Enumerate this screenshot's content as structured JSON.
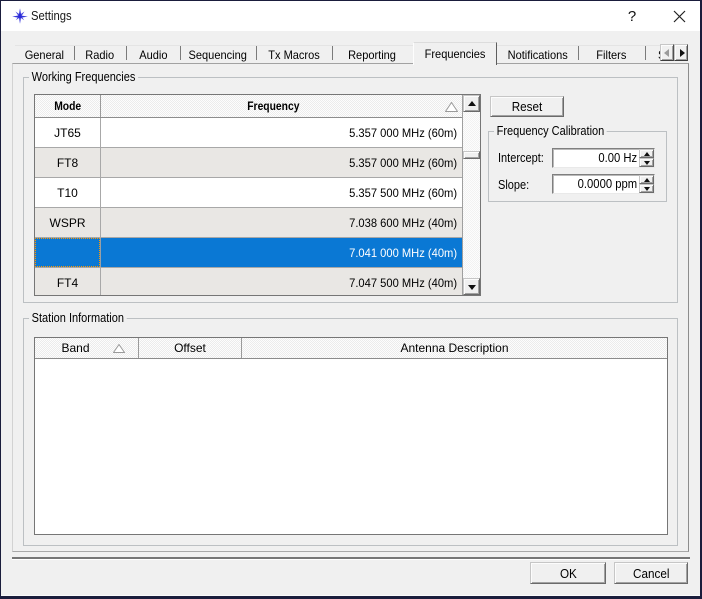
{
  "window": {
    "title": "Settings",
    "help_glyph": "?",
    "icon": "wsjtx-star-icon"
  },
  "tabs": {
    "selected": "Frequencies",
    "items": [
      {
        "label": "General"
      },
      {
        "label": "Radio"
      },
      {
        "label": "Audio"
      },
      {
        "label": "Sequencing"
      },
      {
        "label": "Tx Macros"
      },
      {
        "label": "Reporting"
      },
      {
        "label": "Frequencies"
      },
      {
        "label": "Notifications"
      },
      {
        "label": "Filters"
      },
      {
        "label": "Scheduler"
      }
    ]
  },
  "working_frequencies": {
    "label": "Working Frequencies",
    "columns": {
      "mode": "Mode",
      "frequency": "Frequency"
    },
    "sort_indicator": "ascending",
    "rows": [
      {
        "mode": "JT65",
        "frequency": "5.357 000 MHz (60m)"
      },
      {
        "mode": "FT8",
        "frequency": "5.357 000 MHz (60m)"
      },
      {
        "mode": "T10",
        "frequency": "5.357 500 MHz (60m)"
      },
      {
        "mode": "WSPR",
        "frequency": "7.038 600 MHz (40m)"
      },
      {
        "mode": "",
        "frequency": "7.041 000 MHz (40m)",
        "selected": true
      },
      {
        "mode": "FT4",
        "frequency": "7.047 500 MHz (40m)"
      }
    ],
    "reset_label": "Reset"
  },
  "calibration": {
    "label": "Frequency Calibration",
    "intercept_label": "Intercept:",
    "intercept_value": "0.00 Hz",
    "slope_label": "Slope:",
    "slope_value": "0.0000 ppm"
  },
  "station_information": {
    "label": "Station Information",
    "columns": {
      "band": "Band",
      "offset": "Offset",
      "antenna": "Antenna Description"
    },
    "rows": []
  },
  "buttons": {
    "ok": "OK",
    "cancel": "Cancel"
  },
  "colors": {
    "selection": "#0a78d4",
    "focus_dots": "#ff9800",
    "window_border": "#1a1d3c",
    "titlebar": "#ffffff",
    "dialog_bg": "#f0f0f0",
    "alt_row": "#e9e7e4",
    "icon_blue": "#2a2ad8"
  }
}
